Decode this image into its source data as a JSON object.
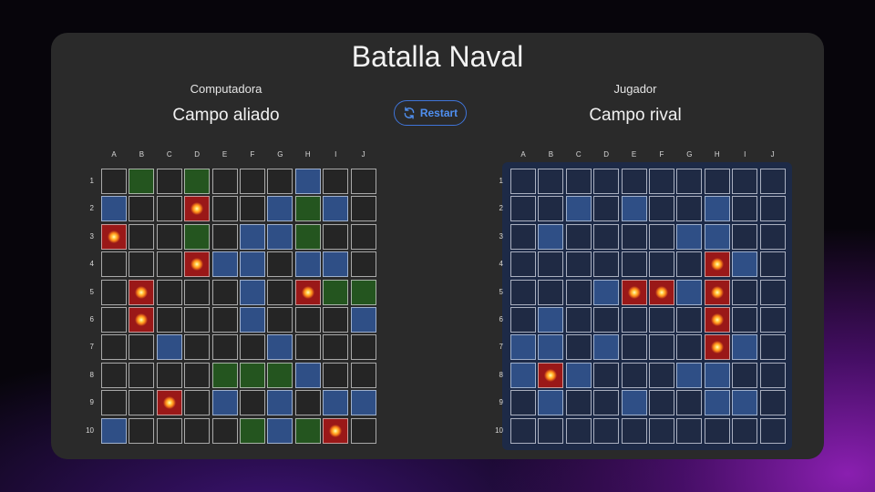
{
  "title": "Batalla Naval",
  "restart_label": "Restart",
  "icon": "refresh-icon",
  "columns": [
    "A",
    "B",
    "C",
    "D",
    "E",
    "F",
    "G",
    "H",
    "I",
    "J"
  ],
  "rows": [
    "1",
    "2",
    "3",
    "4",
    "5",
    "6",
    "7",
    "8",
    "9",
    "10"
  ],
  "colors": {
    "ship": "#24551f",
    "miss": "#2f4f86",
    "hit": "#9a1818",
    "accent": "#3f74d8"
  },
  "left_board": {
    "role": "Computadora",
    "field": "Campo aliado",
    "grid": [
      [
        "empty",
        "ship",
        "empty",
        "ship",
        "empty",
        "empty",
        "empty",
        "miss",
        "empty",
        "empty"
      ],
      [
        "miss",
        "empty",
        "empty",
        "hit",
        "empty",
        "empty",
        "miss",
        "ship",
        "miss",
        "empty"
      ],
      [
        "hit",
        "empty",
        "empty",
        "ship",
        "empty",
        "miss",
        "miss",
        "ship",
        "empty",
        "empty"
      ],
      [
        "empty",
        "empty",
        "empty",
        "hit",
        "miss",
        "miss",
        "empty",
        "miss",
        "miss",
        "empty"
      ],
      [
        "empty",
        "hit",
        "empty",
        "empty",
        "empty",
        "miss",
        "empty",
        "hit",
        "ship",
        "ship"
      ],
      [
        "empty",
        "hit",
        "empty",
        "empty",
        "empty",
        "miss",
        "empty",
        "empty",
        "empty",
        "miss"
      ],
      [
        "empty",
        "empty",
        "miss",
        "empty",
        "empty",
        "empty",
        "miss",
        "empty",
        "empty",
        "empty"
      ],
      [
        "empty",
        "empty",
        "empty",
        "empty",
        "ship",
        "ship",
        "ship",
        "miss",
        "empty",
        "empty"
      ],
      [
        "empty",
        "empty",
        "hit",
        "empty",
        "miss",
        "empty",
        "miss",
        "empty",
        "miss",
        "miss"
      ],
      [
        "miss",
        "empty",
        "empty",
        "empty",
        "empty",
        "ship",
        "miss",
        "ship",
        "hit",
        "empty"
      ]
    ]
  },
  "right_board": {
    "role": "Jugador",
    "field": "Campo rival",
    "grid": [
      [
        "empty",
        "empty",
        "empty",
        "empty",
        "empty",
        "empty",
        "empty",
        "empty",
        "empty",
        "empty"
      ],
      [
        "empty",
        "empty",
        "miss",
        "empty",
        "miss",
        "empty",
        "empty",
        "miss",
        "empty",
        "empty"
      ],
      [
        "empty",
        "miss",
        "empty",
        "empty",
        "empty",
        "empty",
        "miss",
        "miss",
        "empty",
        "empty"
      ],
      [
        "empty",
        "empty",
        "empty",
        "empty",
        "empty",
        "empty",
        "empty",
        "hit",
        "miss",
        "empty"
      ],
      [
        "empty",
        "empty",
        "empty",
        "miss",
        "hit",
        "hit",
        "miss",
        "hit",
        "empty",
        "empty"
      ],
      [
        "empty",
        "miss",
        "empty",
        "empty",
        "empty",
        "empty",
        "empty",
        "hit",
        "empty",
        "empty"
      ],
      [
        "miss",
        "miss",
        "empty",
        "miss",
        "empty",
        "empty",
        "empty",
        "hit",
        "miss",
        "empty"
      ],
      [
        "miss",
        "hit",
        "miss",
        "empty",
        "empty",
        "empty",
        "miss",
        "miss",
        "empty",
        "empty"
      ],
      [
        "empty",
        "miss",
        "empty",
        "empty",
        "miss",
        "empty",
        "empty",
        "miss",
        "miss",
        "empty"
      ],
      [
        "empty",
        "empty",
        "empty",
        "empty",
        "empty",
        "empty",
        "empty",
        "empty",
        "empty",
        "empty"
      ]
    ]
  }
}
